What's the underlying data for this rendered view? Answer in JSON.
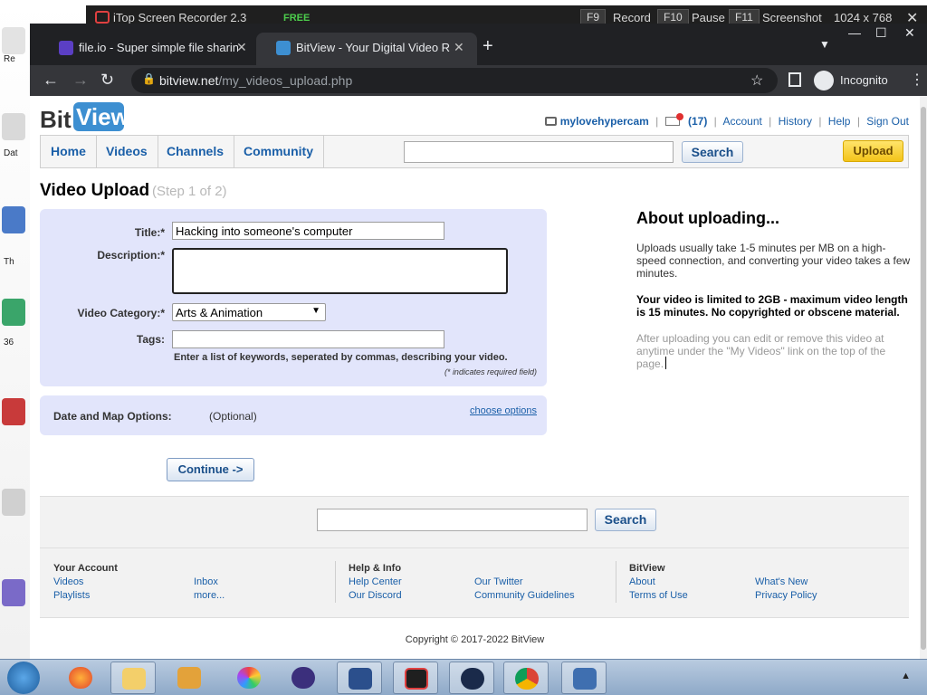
{
  "recorder": {
    "title": "iTop Screen Recorder 2.3",
    "free_badge": "FREE",
    "record_key": "F9",
    "record_label": "Record",
    "pause_key": "F10",
    "pause_label": "Pause",
    "screenshot_key": "F11",
    "screenshot_label": "Screenshot",
    "resolution": "1024 x 768",
    "close": "✕"
  },
  "browser": {
    "tabs": [
      {
        "title": "file.io - Super simple file sharing",
        "close": "✕",
        "favicon_color": "#5b3fc4"
      },
      {
        "title": "BitView - Your Digital Video Repo",
        "close": "✕",
        "favicon_color": "#3d8fd1"
      }
    ],
    "new_tab": "+",
    "tab_search": "▼",
    "window_min": "—",
    "window_max": "☐",
    "window_close": "✕",
    "back": "←",
    "forward": "→",
    "reload": "↻",
    "url_domain": "bitview.net",
    "url_path": "/my_videos_upload.php",
    "lock": "🔒",
    "star": "☆",
    "incognito_label": "Incognito",
    "menu": "⋮"
  },
  "site": {
    "logo_bit": "Bit",
    "logo_view": "View",
    "username": "mylovehypercam",
    "inbox_count": "(17)",
    "links": [
      "Account",
      "History",
      "Help",
      "Sign Out"
    ],
    "nav": [
      "Home",
      "Videos",
      "Channels",
      "Community"
    ],
    "search_button": "Search",
    "upload_button": "Upload",
    "accent_color": "#1a5fa8"
  },
  "upload": {
    "heading": "Video Upload",
    "step": "(Step 1 of 2)",
    "title_label": "Title:*",
    "title_value": "Hacking into someone's computer",
    "description_label": "Description:*",
    "description_value": "",
    "category_label": "Video Category:*",
    "category_value": "Arts & Animation",
    "tags_label": "Tags:",
    "tags_value": "",
    "tags_hint": "Enter a list of keywords, seperated by commas, describing your video.",
    "required_note": "(* indicates required field)",
    "date_map_label": "Date and Map Options:",
    "date_map_optional": "(Optional)",
    "choose_options": "choose options",
    "continue_button": "Continue ->"
  },
  "about": {
    "heading": "About uploading...",
    "p1": "Uploads usually take 1-5 minutes per MB on a high-speed connection, and converting your video takes a few minutes.",
    "p2": "Your video is limited to 2GB - maximum video length is 15 minutes. No copyrighted or obscene material.",
    "p3": "After uploading you can edit or remove this video at anytime under the \"My Videos\" link on the top of the page."
  },
  "footer": {
    "search_button": "Search",
    "your_account": {
      "heading": "Your Account",
      "links": [
        "Videos",
        "Playlists",
        "Inbox",
        "more..."
      ]
    },
    "help_info": {
      "heading": "Help & Info",
      "links": [
        "Help Center",
        "Our Discord",
        "Our Twitter",
        "Community Guidelines"
      ]
    },
    "bitview": {
      "heading": "BitView",
      "links": [
        "About",
        "Terms of Use",
        "What's New",
        "Privacy Policy"
      ]
    },
    "copyright": "Copyright © 2017-2022 BitView"
  },
  "desktop_labels": [
    "Re",
    "Dat",
    "Th",
    "36"
  ],
  "taskbar": {
    "items": [
      "firefox-icon",
      "file-explorer-icon",
      "media-player-icon",
      "photos-icon",
      "spaces-icon",
      "screen-capture-icon",
      "screen-recorder-icon",
      "cloud-app-icon",
      "chrome-icon",
      "remote-desktop-icon"
    ],
    "tray_arrow": "▲"
  }
}
